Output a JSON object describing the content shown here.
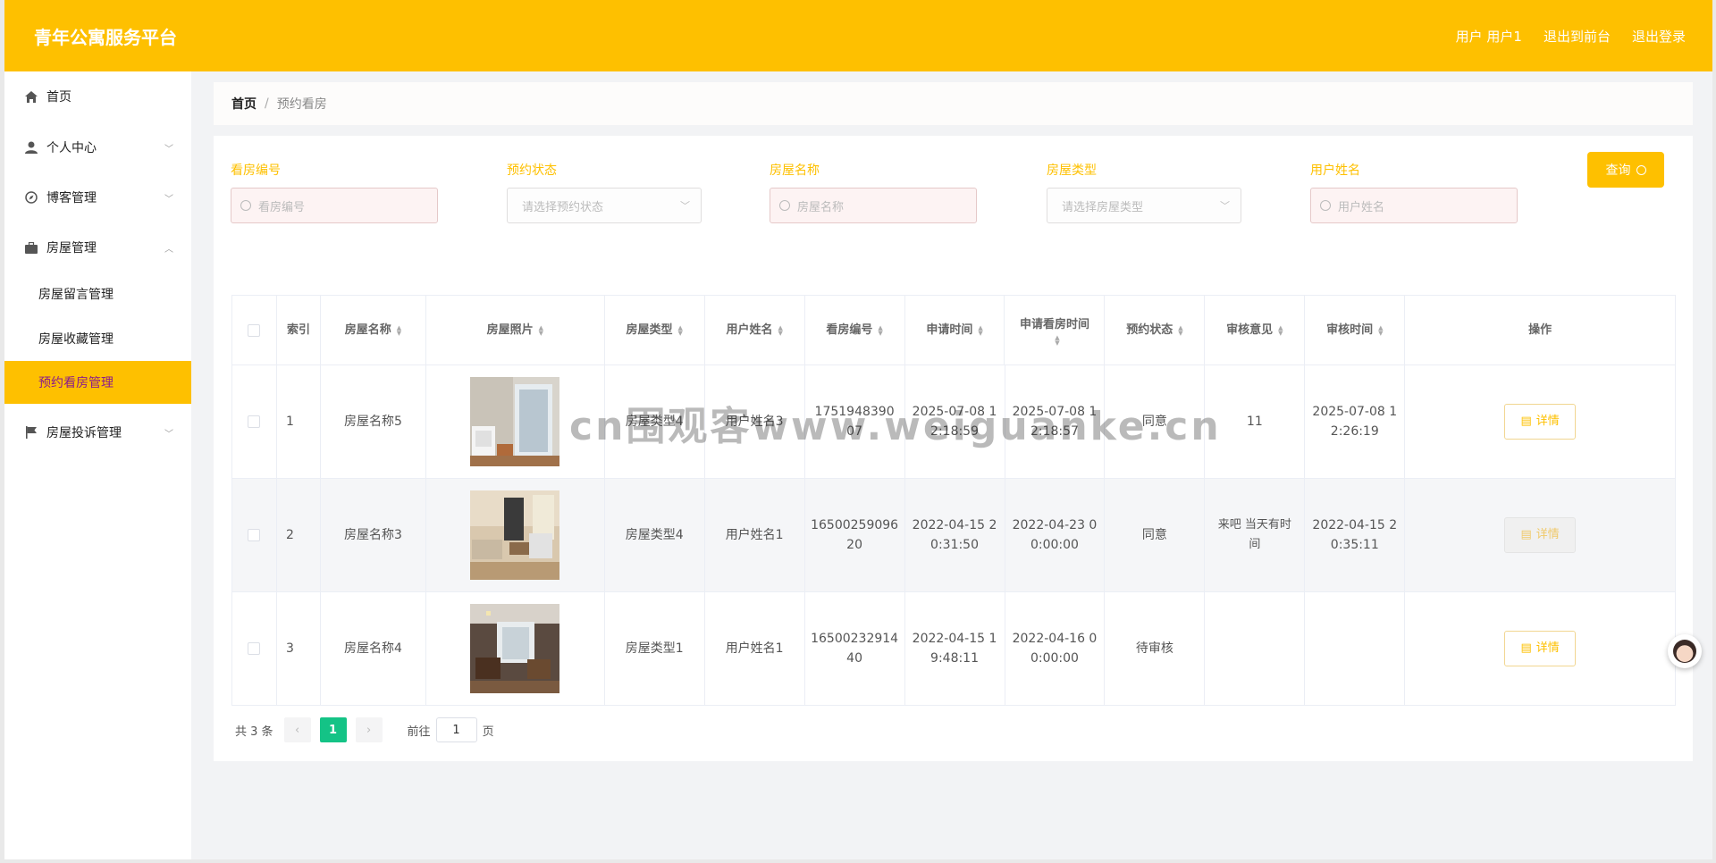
{
  "header": {
    "title": "青年公寓服务平台",
    "user_label": "用户 用户1",
    "back_front": "退出到前台",
    "logout": "退出登录"
  },
  "sidebar": {
    "items": [
      {
        "label": "首页",
        "icon": "home-icon"
      },
      {
        "label": "个人中心",
        "icon": "user-icon"
      },
      {
        "label": "博客管理",
        "icon": "compass-icon"
      },
      {
        "label": "房屋管理",
        "icon": "briefcase-icon"
      },
      {
        "label": "房屋投诉管理",
        "icon": "flag-icon"
      }
    ],
    "submenu": [
      {
        "label": "房屋留言管理"
      },
      {
        "label": "房屋收藏管理"
      },
      {
        "label": "预约看房管理"
      }
    ]
  },
  "breadcrumb": {
    "home": "首页",
    "sep": "/",
    "current": "预约看房"
  },
  "filters": {
    "code_label": "看房编号",
    "code_placeholder": "看房编号",
    "status_label": "预约状态",
    "status_placeholder": "请选择预约状态",
    "name_label": "房屋名称",
    "name_placeholder": "房屋名称",
    "type_label": "房屋类型",
    "type_placeholder": "请选择房屋类型",
    "user_label": "用户姓名",
    "user_placeholder": "用户姓名",
    "query": "查询"
  },
  "table": {
    "headers": [
      "索引",
      "房屋名称",
      "房屋照片",
      "房屋类型",
      "用户姓名",
      "看房编号",
      "申请时间",
      "申请看房时间",
      "预约状态",
      "审核意见",
      "审核时间",
      "操作"
    ],
    "rows": [
      {
        "index": "1",
        "name": "房屋名称5",
        "type": "房屋类型4",
        "user": "用户姓名3",
        "code": "1751948390 07",
        "apply": "2025-07-08 1 2:18:59",
        "visit": "2025-07-08 1 2:18:57",
        "status": "同意",
        "opinion": "11",
        "review": "2025-07-08 1 2:26:19",
        "action": "详情"
      },
      {
        "index": "2",
        "name": "房屋名称3",
        "type": "房屋类型4",
        "user": "用户姓名1",
        "code": "16500259096 20",
        "apply": "2022-04-15 2 0:31:50",
        "visit": "2022-04-23 0 0:00:00",
        "status": "同意",
        "opinion": "来吧 当天有时 间",
        "review": "2022-04-15 2 0:35:11",
        "action": "详情"
      },
      {
        "index": "3",
        "name": "房屋名称4",
        "type": "房屋类型1",
        "user": "用户姓名1",
        "code": "16500232914 40",
        "apply": "2022-04-15 1 9:48:11",
        "visit": "2022-04-16 0 0:00:00",
        "status": "待审核",
        "opinion": "",
        "review": "",
        "action": "详情"
      }
    ]
  },
  "pager": {
    "total": "共 3 条",
    "current": "1",
    "goto_prefix": "前往",
    "goto_value": "1",
    "goto_suffix": "页"
  },
  "watermark": "cn围观客www.weiguanke.cn",
  "colors": {
    "primary": "#fec000",
    "page_active": "#14c386"
  }
}
